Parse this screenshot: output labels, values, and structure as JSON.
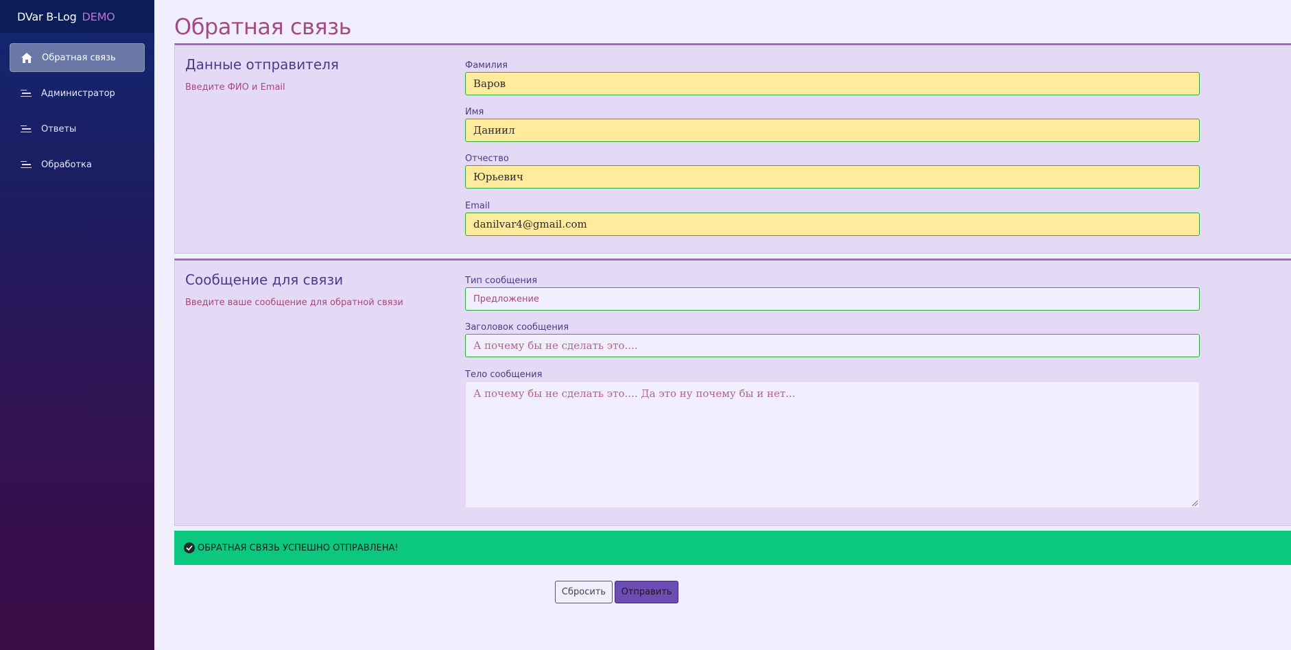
{
  "brand": {
    "name": "DVar B-Log",
    "badge": "DEMO"
  },
  "sidebar": {
    "items": [
      {
        "label": "Обратная связь",
        "icon": "home-icon",
        "active": true
      },
      {
        "label": "Администратор",
        "icon": "list-icon",
        "active": false
      },
      {
        "label": "Ответы",
        "icon": "list-icon",
        "active": false
      },
      {
        "label": "Обработка",
        "icon": "list-icon",
        "active": false
      }
    ]
  },
  "page": {
    "title": "Обратная связь"
  },
  "sender": {
    "heading": "Данные отправителя",
    "subtitle": "Введите ФИО и Email",
    "fields": [
      {
        "label": "Фамилия",
        "value": "Варов"
      },
      {
        "label": "Имя",
        "value": "Даниил"
      },
      {
        "label": "Отчество",
        "value": "Юрьевич"
      },
      {
        "label": "Email",
        "value": "danilvar4@gmail.com"
      }
    ]
  },
  "message": {
    "heading": "Сообщение для связи",
    "subtitle": "Введите ваше сообщение для обратной связи",
    "type": {
      "label": "Тип сообщения",
      "value": "Предложение"
    },
    "subject": {
      "label": "Заголовок сообщения",
      "placeholder": "А почему бы не сделать это...."
    },
    "body": {
      "label": "Тело сообщения",
      "placeholder": "А почему бы не сделать это.... Да это ну почему бы и нет..."
    }
  },
  "alert": {
    "text": "ОБРАТНАЯ СВЯЗЬ УСПЕШНО ОТПРАВЛЕНА!"
  },
  "actions": {
    "reset_label": "Сбросить",
    "submit_label": "Отправить"
  },
  "colors": {
    "accent": "#a44a85",
    "filled_field": "#ffeb9b",
    "success": "#0bc77f",
    "submit": "#6d4db3"
  }
}
